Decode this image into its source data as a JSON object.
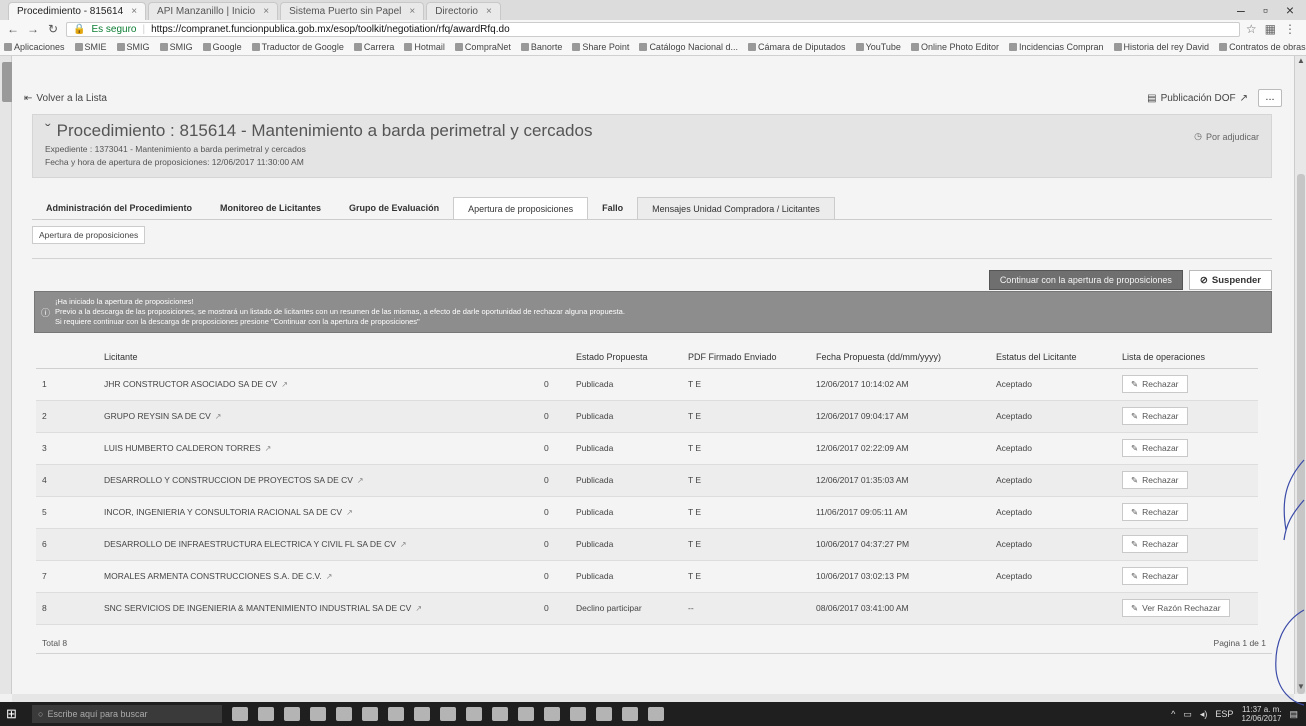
{
  "browser": {
    "tabs": [
      {
        "label": "Procedimiento - 815614",
        "active": true
      },
      {
        "label": "API Manzanillo | Inicio",
        "active": false
      },
      {
        "label": "Sistema Puerto sin Papel",
        "active": false
      },
      {
        "label": "Directorio",
        "active": false
      }
    ],
    "url_secure": "Es seguro",
    "url": "https://compranet.funcionpublica.gob.mx/esop/toolkit/negotiation/rfq/awardRfq.do",
    "bookmarks": [
      "Aplicaciones",
      "SMIE",
      "SMIG",
      "SMIG",
      "Google",
      "Traductor de Google",
      "Carrera",
      "Hotmail",
      "CompraNet",
      "Banorte",
      "Share Point",
      "Catálogo Nacional d...",
      "Cámara de Diputados",
      "YouTube",
      "Online Photo Editor",
      "Incidencias Compran",
      "Historia del rey David",
      "Contratos de obras p..."
    ]
  },
  "page": {
    "back_label": "Volver a la Lista",
    "pub_dof": "Publicación DOF",
    "more": "...",
    "title": "Procedimiento : 815614 - Mantenimiento a barda perimetral y cercados",
    "expediente": "Expediente : 1373041  - Mantenimiento a barda perimetral y cercados",
    "fecha_apertura": "Fecha y hora de apertura de proposiciones: 12/06/2017 11:30:00 AM",
    "status": "Por adjudicar",
    "tabs": [
      "Administración del Procedimiento",
      "Monitoreo de Licitantes",
      "Grupo de Evaluación",
      "Apertura de proposiciones",
      "Fallo",
      "Mensajes Unidad Compradora / Licitantes"
    ],
    "subtab": "Apertura de proposiciones",
    "btn_continue": "Continuar con la apertura de proposiciones",
    "btn_suspend": "Suspender",
    "alert_lines": [
      "¡Ha iniciado la apertura de proposiciones!",
      "Previo a la descarga de las proposiciones, se mostrará un listado de licitantes con un resumen de las mismas, a efecto de darle oportunidad de rechazar alguna propuesta.",
      "Si requiere continuar con la descarga de proposiciones presione \"Continuar con la apertura de proposiciones\""
    ],
    "table": {
      "headers": [
        "",
        "Licitante",
        "",
        "Estado Propuesta",
        "PDF Firmado Enviado",
        "Fecha Propuesta (dd/mm/yyyy)",
        "Estatus del Licitante",
        "Lista de operaciones"
      ],
      "rows": [
        {
          "n": "1",
          "name": "JHR CONSTRUCTOR ASOCIADO SA DE CV",
          "c": "0",
          "estado": "Publicada",
          "pdf": "T E",
          "fecha": "12/06/2017 10:14:02 AM",
          "estatus": "Aceptado",
          "op": "Rechazar"
        },
        {
          "n": "2",
          "name": "GRUPO REYSIN SA DE CV",
          "c": "0",
          "estado": "Publicada",
          "pdf": "T E",
          "fecha": "12/06/2017 09:04:17 AM",
          "estatus": "Aceptado",
          "op": "Rechazar"
        },
        {
          "n": "3",
          "name": "LUIS HUMBERTO CALDERON TORRES",
          "c": "0",
          "estado": "Publicada",
          "pdf": "T E",
          "fecha": "12/06/2017 02:22:09 AM",
          "estatus": "Aceptado",
          "op": "Rechazar"
        },
        {
          "n": "4",
          "name": "DESARROLLO Y CONSTRUCCION DE PROYECTOS SA DE CV",
          "c": "0",
          "estado": "Publicada",
          "pdf": "T E",
          "fecha": "12/06/2017 01:35:03 AM",
          "estatus": "Aceptado",
          "op": "Rechazar"
        },
        {
          "n": "5",
          "name": "INCOR, INGENIERIA Y CONSULTORIA RACIONAL SA DE CV",
          "c": "0",
          "estado": "Publicada",
          "pdf": "T E",
          "fecha": "11/06/2017 09:05:11 AM",
          "estatus": "Aceptado",
          "op": "Rechazar"
        },
        {
          "n": "6",
          "name": "DESARROLLO DE INFRAESTRUCTURA ELECTRICA Y CIVIL FL SA DE CV",
          "c": "0",
          "estado": "Publicada",
          "pdf": "T E",
          "fecha": "10/06/2017 04:37:27 PM",
          "estatus": "Aceptado",
          "op": "Rechazar"
        },
        {
          "n": "7",
          "name": "MORALES ARMENTA CONSTRUCCIONES S.A. DE C.V.",
          "c": "0",
          "estado": "Publicada",
          "pdf": "T E",
          "fecha": "10/06/2017 03:02:13 PM",
          "estatus": "Aceptado",
          "op": "Rechazar"
        },
        {
          "n": "8",
          "name": "SNC SERVICIOS DE INGENIERIA & MANTENIMIENTO INDUSTRIAL SA DE CV",
          "c": "0",
          "estado": "Declino participar",
          "pdf": "--",
          "fecha": "08/06/2017 03:41:00 AM",
          "estatus": "",
          "op": "Ver Razón Rechazar"
        }
      ]
    },
    "total": "Total 8",
    "pagination": "Pagina 1 de 1"
  },
  "taskbar": {
    "search_placeholder": "Escribe aquí para buscar",
    "lang": "ESP",
    "time": "11:37 a. m.",
    "date": "12/06/2017"
  }
}
